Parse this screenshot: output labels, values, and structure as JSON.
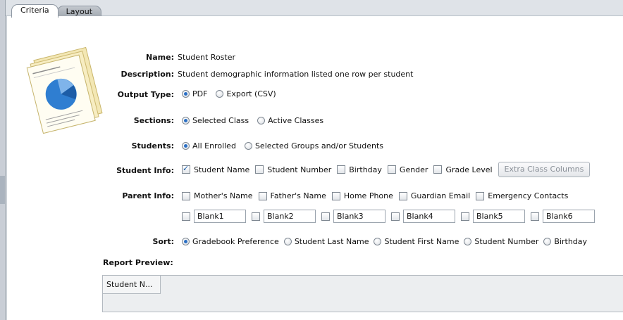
{
  "tabs": [
    {
      "label": "Criteria",
      "active": true
    },
    {
      "label": "Layout",
      "active": false
    }
  ],
  "report_icon": "report-document-icon",
  "fields": {
    "name": {
      "label": "Name:",
      "value": "Student Roster"
    },
    "description": {
      "label": "Description:",
      "value": "Student demographic information listed one row per student"
    },
    "output_type": {
      "label": "Output Type:",
      "options": [
        "PDF",
        "Export (CSV)"
      ],
      "selected": "PDF"
    },
    "sections": {
      "label": "Sections:",
      "options": [
        "Selected Class",
        "Active Classes"
      ],
      "selected": "Selected Class"
    },
    "students": {
      "label": "Students:",
      "options": [
        "All Enrolled",
        "Selected Groups and/or Students"
      ],
      "selected": "All Enrolled"
    },
    "student_info": {
      "label": "Student Info:",
      "options": [
        {
          "label": "Student Name",
          "checked": true
        },
        {
          "label": "Student Number",
          "checked": false
        },
        {
          "label": "Birthday",
          "checked": false
        },
        {
          "label": "Gender",
          "checked": false
        },
        {
          "label": "Grade Level",
          "checked": false
        }
      ],
      "extra_button": "Extra Class Columns"
    },
    "parent_info": {
      "label": "Parent Info:",
      "options": [
        {
          "label": "Mother's Name",
          "checked": false
        },
        {
          "label": "Father's Name",
          "checked": false
        },
        {
          "label": "Home Phone",
          "checked": false
        },
        {
          "label": "Guardian Email",
          "checked": false
        },
        {
          "label": "Emergency Contacts",
          "checked": false
        }
      ]
    },
    "blanks": [
      {
        "value": "Blank1",
        "checked": false
      },
      {
        "value": "Blank2",
        "checked": false
      },
      {
        "value": "Blank3",
        "checked": false
      },
      {
        "value": "Blank4",
        "checked": false
      },
      {
        "value": "Blank5",
        "checked": false
      },
      {
        "value": "Blank6",
        "checked": false
      }
    ],
    "sort": {
      "label": "Sort:",
      "options": [
        "Gradebook Preference",
        "Student Last Name",
        "Student First Name",
        "Student Number",
        "Birthday"
      ],
      "selected": "Gradebook Preference"
    },
    "report_preview": {
      "label": "Report Preview:",
      "column_header": "Student N..."
    }
  },
  "colors": {
    "accent": "#2b6fc4",
    "tab_bar": "#dfe3e8",
    "preview_bg": "#eceef0"
  }
}
